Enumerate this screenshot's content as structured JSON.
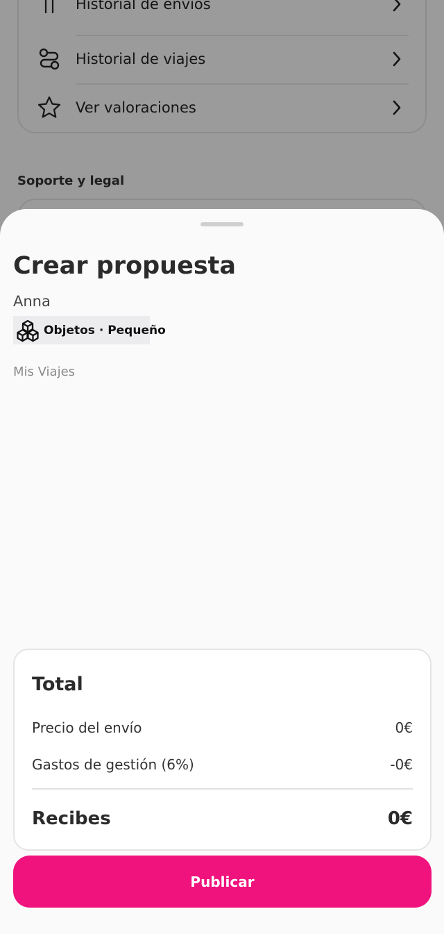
{
  "background": {
    "menu_items": [
      {
        "label": "Historial de envíos",
        "icon": "package-icon"
      },
      {
        "label": "Historial de viajes",
        "icon": "route-icon"
      },
      {
        "label": "Ver valoraciones",
        "icon": "star-icon"
      }
    ],
    "section_title": "Soporte y legal"
  },
  "sheet": {
    "title": "Crear propuesta",
    "user_name": "Anna",
    "tag": {
      "label": "Objetos · Pequeño",
      "icon": "cubes-icon"
    },
    "trips_label": "Mis Viajes"
  },
  "total": {
    "title": "Total",
    "shipping_label": "Precio del envío",
    "shipping_value": "0€",
    "fee_label": "Gastos de gestión (6%)",
    "fee_value": "-0€",
    "receive_label": "Recibes",
    "receive_value": "0€"
  },
  "actions": {
    "publish_label": "Publicar"
  },
  "colors": {
    "accent": "#f0127d",
    "sheet_bg": "#fafafa",
    "text": "#2b2b2b"
  }
}
